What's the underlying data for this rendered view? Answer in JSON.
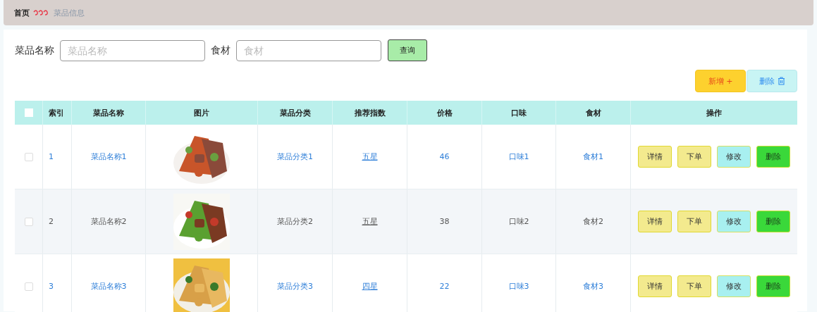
{
  "breadcrumb": {
    "home": "首页",
    "current": "菜品信息"
  },
  "search": {
    "fields": [
      {
        "label": "菜品名称",
        "placeholder": "菜品名称"
      },
      {
        "label": "食材",
        "placeholder": "食材"
      }
    ],
    "button": "查询"
  },
  "actions": [
    {
      "kind": "add",
      "label": "新增 +"
    },
    {
      "kind": "delete",
      "label": "删除"
    }
  ],
  "table": {
    "columns": [
      "索引",
      "菜品名称",
      "图片",
      "菜品分类",
      "推荐指数",
      "价格",
      "口味",
      "食材",
      "操作"
    ],
    "select_all": {
      "checked": false
    },
    "rows": [
      {
        "checked": false,
        "highlighted": true,
        "index": "1",
        "name": "菜品名称1",
        "category": "菜品分类1",
        "rating": "五星",
        "price": "46",
        "taste": "口味1",
        "ingredient": "食材1",
        "buttons": [
          {
            "kind": "detail",
            "label": "详情"
          },
          {
            "kind": "order",
            "label": "下单"
          },
          {
            "kind": "edit",
            "label": "修改"
          },
          {
            "kind": "delete",
            "label": "删除"
          }
        ]
      },
      {
        "checked": false,
        "highlighted": false,
        "index": "2",
        "name": "菜品名称2",
        "category": "菜品分类2",
        "rating": "五星",
        "price": "38",
        "taste": "口味2",
        "ingredient": "食材2",
        "buttons": [
          {
            "kind": "detail",
            "label": "详情"
          },
          {
            "kind": "order",
            "label": "下单"
          },
          {
            "kind": "edit",
            "label": "修改"
          },
          {
            "kind": "delete",
            "label": "删除"
          }
        ]
      },
      {
        "checked": false,
        "highlighted": true,
        "index": "3",
        "name": "菜品名称3",
        "category": "菜品分类3",
        "rating": "四星",
        "price": "22",
        "taste": "口味3",
        "ingredient": "食材3",
        "buttons": [
          {
            "kind": "detail",
            "label": "详情"
          },
          {
            "kind": "order",
            "label": "下单"
          },
          {
            "kind": "edit",
            "label": "修改"
          },
          {
            "kind": "delete",
            "label": "删除"
          }
        ]
      }
    ]
  }
}
